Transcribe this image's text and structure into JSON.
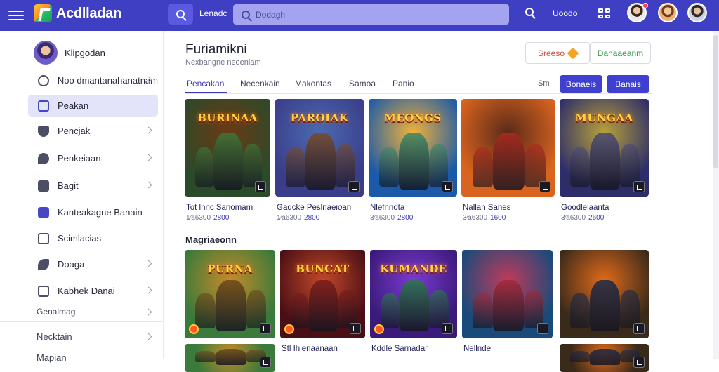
{
  "header": {
    "app_name": "Acdlladan",
    "top_label": "Lenadc",
    "search_placeholder": "Dodagh",
    "user_label": "Uoodo"
  },
  "sidebar": {
    "profile_name": "Klipgodan",
    "items": [
      {
        "label": "Noo dmantanahanatnam",
        "icon": "search-circle-icon",
        "chevron": true
      },
      {
        "label": "Peakan",
        "icon": "square-icon",
        "chevron": false,
        "active": true
      },
      {
        "label": "Pencjak",
        "icon": "shield-icon",
        "chevron": true
      },
      {
        "label": "Penkeiaan",
        "icon": "chat-bubble-icon",
        "chevron": true
      },
      {
        "label": "Bagit",
        "icon": "bag-icon",
        "chevron": true
      },
      {
        "label": "Kanteakagne Banain",
        "icon": "heart-icon",
        "chevron": false
      },
      {
        "label": "Scimlacias",
        "icon": "window-icon",
        "chevron": false
      },
      {
        "label": "Doaga",
        "icon": "leaf-icon",
        "chevron": true
      },
      {
        "label": "Kabhek Danai",
        "icon": "box-icon",
        "chevron": true
      }
    ],
    "section_label": "Genaimag",
    "lower_items": [
      "Necktain",
      "Mapian"
    ]
  },
  "main": {
    "title": "Furiamikni",
    "subtitle": "Nexbangne neoenlam",
    "button_a": "Sreeso",
    "button_b": "Danaaeanm",
    "tabs": [
      "Pencakan",
      "Necenkain",
      "Makontas",
      "Samoa",
      "Panio"
    ],
    "active_tab": 0,
    "sort_label": "Sm",
    "solid_btn_1": "Bonaeis",
    "solid_btn_2": "Banais",
    "section_title": "Magriaeonn"
  },
  "row1": [
    {
      "title": "Tot lnnc Sanomam",
      "meta": "1⁄a6300",
      "price": "2800",
      "art_title": "BURINAA",
      "bg": [
        "#2b4a2a",
        "#6b3a14"
      ],
      "hero": "#3f7a3a"
    },
    {
      "title": "Gadcke Peslnaeioan",
      "meta": "1⁄a6300",
      "price": "2800",
      "art_title": "PAROIAK",
      "bg": [
        "#3a3d8a",
        "#4b6ab0"
      ],
      "hero": "#7a4a2a"
    },
    {
      "title": "Nlefnnota",
      "meta": "3⁄a6300",
      "price": "2800",
      "art_title": "MEONGS",
      "bg": [
        "#1b5aa8",
        "#f2b23a"
      ],
      "hero": "#3a8a6a"
    },
    {
      "title": "Nallan Sanes",
      "meta": "3⁄a6300",
      "price": "1600",
      "art_title": "",
      "bg": [
        "#d9641f",
        "#5a2a18"
      ],
      "hero": "#b02a1f"
    },
    {
      "title": "Goodlelaanta",
      "meta": "3⁄a6300",
      "price": "2600",
      "art_title": "MUNGAA",
      "bg": [
        "#2d2d6a",
        "#b8a23a"
      ],
      "hero": "#4a4a7a"
    }
  ],
  "row2": [
    {
      "title": "",
      "meta": "",
      "price": "",
      "art_title": "PURNA",
      "bg": [
        "#3a7a3a",
        "#c78a2a"
      ],
      "hero": "#6a4a1a"
    },
    {
      "title": "",
      "meta": "",
      "price": "",
      "art_title": "BUNCAT",
      "bg": [
        "#4a0f14",
        "#c2482a"
      ],
      "hero": "#7a1a1a"
    },
    {
      "title": "",
      "meta": "",
      "price": "",
      "art_title": "KUMANDE",
      "bg": [
        "#3a1a7a",
        "#7a3ad0"
      ],
      "hero": "#2a7a4a"
    },
    {
      "title": "",
      "meta": "",
      "price": "",
      "art_title": "",
      "bg": [
        "#1a4a7a",
        "#c23a5a"
      ],
      "hero": "#a02a3a"
    },
    {
      "title": "",
      "meta": "",
      "price": "",
      "art_title": "",
      "bg": [
        "#3a2a1a",
        "#e26a1a"
      ],
      "hero": "#1a2a4a"
    }
  ],
  "row3_titles": [
    "",
    "Stl Ihlenaanaan",
    "Kddle Sarnadar",
    "Nellnde",
    ""
  ],
  "colors": {
    "accent": "#3f3fc4",
    "accent_light": "#e3e4fa",
    "chip_green": "#2f9a4f",
    "chip_red": "#d24b3a"
  }
}
